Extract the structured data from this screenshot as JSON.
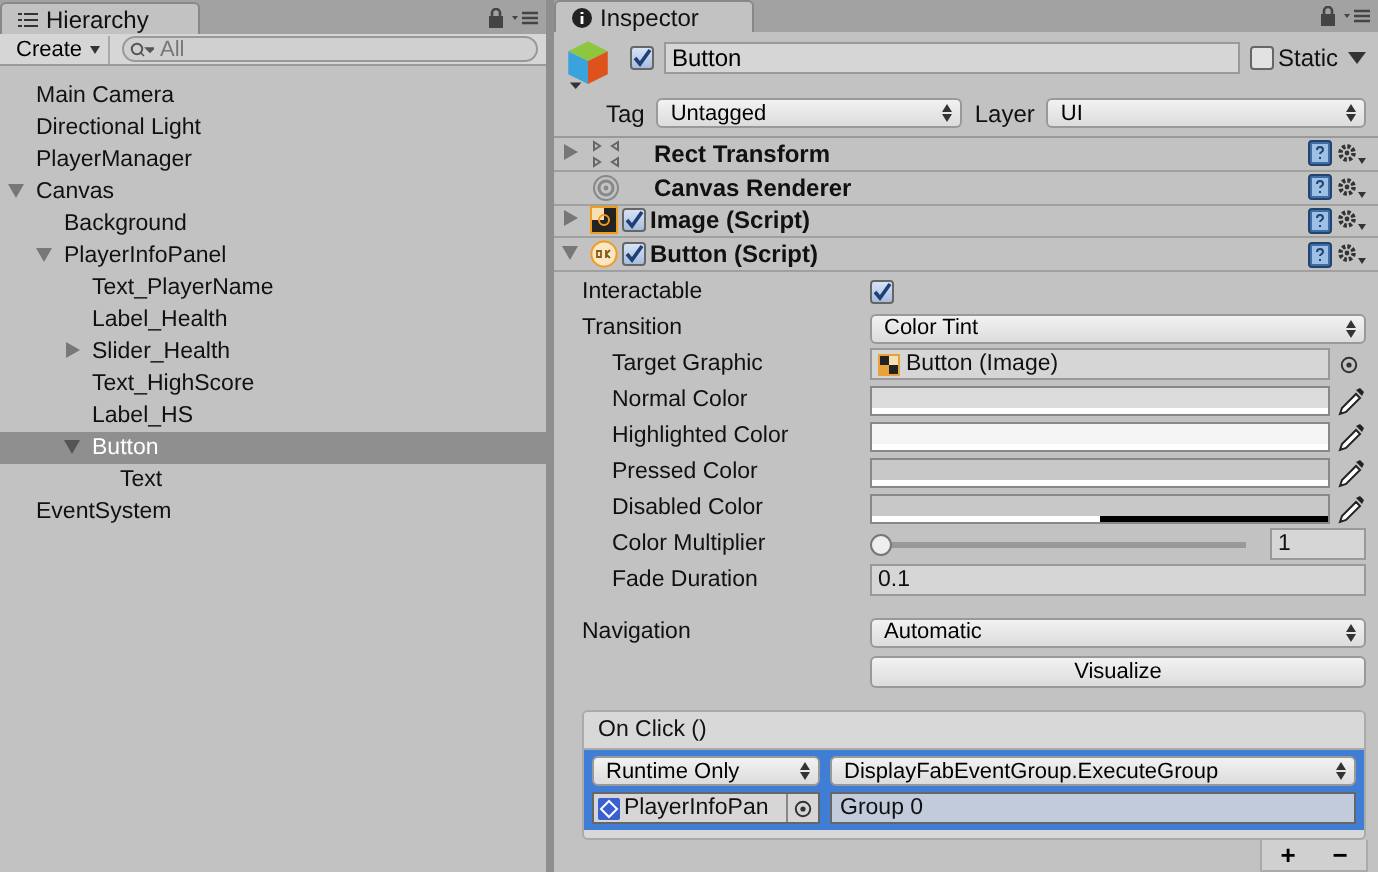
{
  "hierarchy": {
    "title": "Hierarchy",
    "create_label": "Create",
    "search_placeholder": "All",
    "items": [
      {
        "label": "Main Camera",
        "selected": false
      },
      {
        "label": "Directional Light",
        "selected": false
      },
      {
        "label": "PlayerManager",
        "selected": false
      },
      {
        "label": "Canvas",
        "selected": false,
        "expanded": true,
        "children": [
          {
            "label": "Background",
            "selected": false
          },
          {
            "label": "PlayerInfoPanel",
            "selected": false,
            "expanded": true,
            "children": [
              {
                "label": "Text_PlayerName",
                "selected": false
              },
              {
                "label": "Label_Health",
                "selected": false
              },
              {
                "label": "Slider_Health",
                "selected": false,
                "expanded": false
              },
              {
                "label": "Text_HighScore",
                "selected": false
              },
              {
                "label": "Label_HS",
                "selected": false
              },
              {
                "label": "Button",
                "selected": true,
                "expanded": true,
                "children": [
                  {
                    "label": "Text",
                    "selected": false
                  }
                ]
              }
            ]
          }
        ]
      },
      {
        "label": "EventSystem",
        "selected": false
      }
    ]
  },
  "inspector": {
    "title": "Inspector",
    "object": {
      "active": true,
      "name": "Button",
      "static": false,
      "static_label": "Static",
      "tag_label": "Tag",
      "tag": "Untagged",
      "layer_label": "Layer",
      "layer": "UI"
    },
    "components": [
      {
        "name": "Rect Transform",
        "kind": "transform",
        "expanded": false
      },
      {
        "name": "Canvas Renderer",
        "kind": "renderer"
      },
      {
        "name": "Image (Script)",
        "kind": "image",
        "expanded": false,
        "enabled": true
      },
      {
        "name": "Button (Script)",
        "kind": "button",
        "expanded": true,
        "enabled": true
      }
    ],
    "properties": [
      {
        "label": "Interactable",
        "kind": "checkbox",
        "checked": true
      },
      {
        "label": "Transition",
        "kind": "dropdown",
        "value": "Color Tint",
        "children": [
          {
            "label": "Target Graphic",
            "kind": "object",
            "value": "Button (Image)"
          },
          {
            "label": "Normal Color",
            "kind": "color",
            "color": "#dcdcdc",
            "level": 1
          },
          {
            "label": "Highlighted Color",
            "kind": "color",
            "color": "#f5f5f5",
            "level": 1
          },
          {
            "label": "Pressed Color",
            "kind": "color",
            "color": "#c8c8c8",
            "level": 1
          },
          {
            "label": "Disabled Color",
            "kind": "color",
            "color": "#c8c8c8",
            "level": 0.5
          },
          {
            "label": "Color Multiplier",
            "kind": "slider",
            "level": 0,
            "value": "1"
          },
          {
            "label": "Fade Duration",
            "kind": "text",
            "value": "0.1"
          }
        ]
      },
      {
        "label": "Navigation",
        "kind": "dropdown",
        "value": "Automatic",
        "button": "Visualize"
      }
    ],
    "on_click": {
      "title": "On Click ()",
      "listeners": [
        {
          "mode": "Runtime Only",
          "function": "DisplayFabEventGroup.ExecuteGroup",
          "target": "PlayerInfoPan",
          "argument": "Group 0"
        }
      ],
      "add_label": "+",
      "remove_label": "−"
    }
  }
}
